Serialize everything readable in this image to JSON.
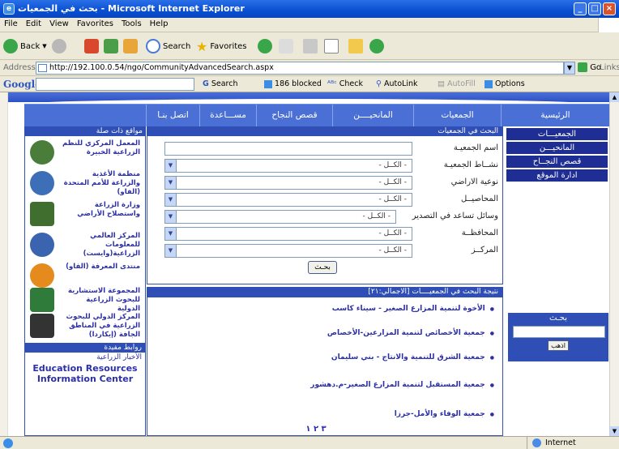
{
  "window": {
    "title": "بحث في الجمعيات - Microsoft Internet Explorer",
    "buttons": [
      "_",
      "□",
      "×"
    ]
  },
  "menu": [
    "File",
    "Edit",
    "View",
    "Favorites",
    "Tools",
    "Help"
  ],
  "toolbar": {
    "back": "Back",
    "search": "Search",
    "favorites": "Favorites"
  },
  "address": {
    "label": "Address",
    "url": "http://192.100.0.54/ngo/CommunityAdvancedSearch.aspx",
    "go": "Go",
    "links": "Links"
  },
  "google": {
    "logo": "Google",
    "search": "Search",
    "blocked": "186 blocked",
    "check": "Check",
    "autolink": "AutoLink",
    "autofill": "AutoFill",
    "options": "Options"
  },
  "nav": [
    "الرئيسية",
    "الجمعيات",
    "المانحيــــن",
    "قصص النجاح",
    "مســـاعدة",
    "اتصل بنـا"
  ],
  "right_menu": [
    "الجمعيـــات",
    "المانحيـــن",
    "قصص النجــاح",
    "ادارة الموقع"
  ],
  "right_search": {
    "label": "بحـث",
    "button": "اذهب"
  },
  "search_form": {
    "heading": "البحث في الجمعيات",
    "fields": [
      {
        "label": "اسم الجمعيـة",
        "type": "text",
        "value": ""
      },
      {
        "label": "نشــاط الجمعيـة",
        "type": "select",
        "value": "- الكــل -"
      },
      {
        "label": "نوعية الاراضي",
        "type": "select",
        "value": "- الكــل -"
      },
      {
        "label": "المحاصيــل",
        "type": "select",
        "value": "- الكــل -"
      },
      {
        "label": "وسائل تساعد في التصدير",
        "type": "select",
        "value": "- الكــل -"
      },
      {
        "label": "المحافظــة",
        "type": "select",
        "value": "- الكــل -"
      },
      {
        "label": "المركــز",
        "type": "select",
        "value": "- الكــل -"
      }
    ],
    "submit": "بحـث"
  },
  "results": {
    "heading": "نتيجة البحث في الجمعيــــات    [الاجمالي:٢١]",
    "items": [
      "الأخوة لتنمية المزارع الصغير - سيناء كاسب",
      "جمعية الأخصائص لتنمية المزارعين-الأخصاص",
      "جمعية الشرق للتنمية والانتاج - بني سليمان",
      "جمعية المستقبل لتنمية المزارع الصغير-م.دهشور",
      "جمعية الوفاء والأمل-جرزا"
    ],
    "pager": "٣ ٢ ١"
  },
  "links_panel": {
    "heading": "مواقع ذات صلة",
    "items": [
      {
        "text": "المعمل المركزي للنظم الزراعية الخبيرة",
        "logo_color": "#4b7d3a"
      },
      {
        "text": "منظمة الأغذية والزراعة للأمم المتحدة (الفاو)",
        "logo_color": "#3c6fb8"
      },
      {
        "text": "وزارة الزراعة واستصلاح الأراضي",
        "logo_color": "#3f6e2f"
      },
      {
        "text": "المركز العالمي للمعلومات الزراعية(وايست)",
        "logo_color": "#3a64b0"
      },
      {
        "text": "منتدى المعرفة (الفاو)",
        "logo_color": "#e58a1c"
      },
      {
        "text": "المجموعة الاستشارية للبحوث الزراعية الدولية",
        "logo_color": "#2f7c3a"
      },
      {
        "text": "المركز الدولي للبحوث الزراعية في المناطق الجافة (إيكاردا)",
        "logo_color": "#333333"
      }
    ],
    "heading2": "روابط مفيدة",
    "useful": [
      "الأخبار الزراعية",
      "Education Resources",
      "Information Center"
    ]
  },
  "status": {
    "zone": "Internet"
  }
}
